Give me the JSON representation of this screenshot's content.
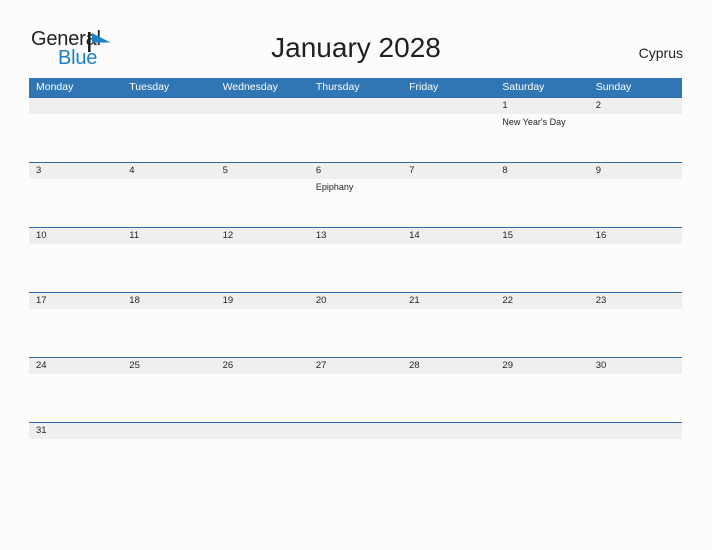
{
  "brand": {
    "word1": "General",
    "word2": "Blue",
    "flag_icon": "blue-pennant-icon",
    "color_dark": "#231f20",
    "color_blue": "#1d81c5"
  },
  "header": {
    "title": "January 2028",
    "country": "Cyprus"
  },
  "colors": {
    "header_blue": "#3075b4",
    "rule_blue": "#2d6ca8",
    "band_gray": "#efefef",
    "page_bg": "#fcfcfd",
    "text": "#231f20"
  },
  "weekdays": [
    "Monday",
    "Tuesday",
    "Wednesday",
    "Thursday",
    "Friday",
    "Saturday",
    "Sunday"
  ],
  "weeks": [
    {
      "days": [
        {
          "number": "",
          "event": ""
        },
        {
          "number": "",
          "event": ""
        },
        {
          "number": "",
          "event": ""
        },
        {
          "number": "",
          "event": ""
        },
        {
          "number": "",
          "event": ""
        },
        {
          "number": "1",
          "event": "New Year's Day"
        },
        {
          "number": "2",
          "event": ""
        }
      ]
    },
    {
      "days": [
        {
          "number": "3",
          "event": ""
        },
        {
          "number": "4",
          "event": ""
        },
        {
          "number": "5",
          "event": ""
        },
        {
          "number": "6",
          "event": "Epiphany"
        },
        {
          "number": "7",
          "event": ""
        },
        {
          "number": "8",
          "event": ""
        },
        {
          "number": "9",
          "event": ""
        }
      ]
    },
    {
      "days": [
        {
          "number": "10",
          "event": ""
        },
        {
          "number": "11",
          "event": ""
        },
        {
          "number": "12",
          "event": ""
        },
        {
          "number": "13",
          "event": ""
        },
        {
          "number": "14",
          "event": ""
        },
        {
          "number": "15",
          "event": ""
        },
        {
          "number": "16",
          "event": ""
        }
      ]
    },
    {
      "days": [
        {
          "number": "17",
          "event": ""
        },
        {
          "number": "18",
          "event": ""
        },
        {
          "number": "19",
          "event": ""
        },
        {
          "number": "20",
          "event": ""
        },
        {
          "number": "21",
          "event": ""
        },
        {
          "number": "22",
          "event": ""
        },
        {
          "number": "23",
          "event": ""
        }
      ]
    },
    {
      "days": [
        {
          "number": "24",
          "event": ""
        },
        {
          "number": "25",
          "event": ""
        },
        {
          "number": "26",
          "event": ""
        },
        {
          "number": "27",
          "event": ""
        },
        {
          "number": "28",
          "event": ""
        },
        {
          "number": "29",
          "event": ""
        },
        {
          "number": "30",
          "event": ""
        }
      ]
    },
    {
      "short": true,
      "days": [
        {
          "number": "31",
          "event": ""
        },
        {
          "number": "",
          "event": ""
        },
        {
          "number": "",
          "event": ""
        },
        {
          "number": "",
          "event": ""
        },
        {
          "number": "",
          "event": ""
        },
        {
          "number": "",
          "event": ""
        },
        {
          "number": "",
          "event": ""
        }
      ]
    }
  ]
}
